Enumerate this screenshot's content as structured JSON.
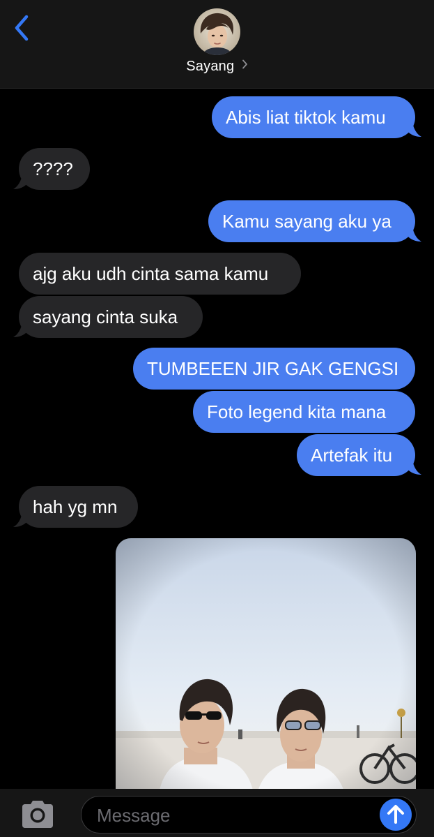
{
  "header": {
    "contact_name": "Sayang",
    "back_icon": "chevron-left-icon",
    "chevron_icon": "chevron-right-icon"
  },
  "messages": [
    {
      "direction": "out",
      "text": "Abis liat tiktok kamu"
    },
    {
      "direction": "in",
      "text": "????"
    },
    {
      "direction": "out",
      "text": "Kamu sayang aku ya"
    },
    {
      "direction": "in",
      "text": "ajg aku udh cinta sama kamu"
    },
    {
      "direction": "in",
      "text": "sayang cinta suka"
    },
    {
      "direction": "out",
      "text": "TUMBEEEN JIR GAK GENGSI"
    },
    {
      "direction": "out",
      "text": "Foto legend kita mana"
    },
    {
      "direction": "out",
      "text": "Artefak itu"
    },
    {
      "direction": "in",
      "text": "hah yg mn"
    },
    {
      "direction": "in",
      "type": "photo"
    }
  ],
  "input": {
    "placeholder": "Message",
    "value": "",
    "camera_icon": "camera-icon",
    "send_icon": "arrow-up-icon"
  },
  "colors": {
    "outgoing_bubble": "#4a7ef0",
    "incoming_bubble": "#262628",
    "accent": "#3478f6",
    "background": "#000000",
    "bar_background": "#161616"
  }
}
